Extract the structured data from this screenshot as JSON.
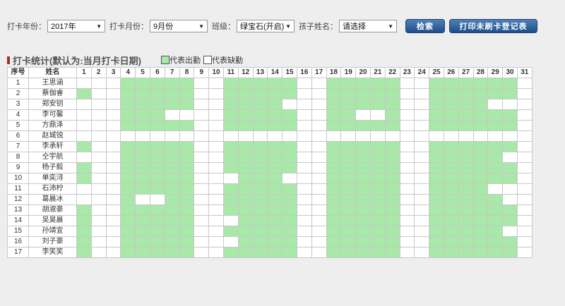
{
  "filters": {
    "year_label": "打卡年份：",
    "year_value": "2017年",
    "month_label": "打卡月份：",
    "month_value": "9月份",
    "class_label": "班级：",
    "class_value": "绿宝石(开启)",
    "child_label": "孩子姓名：",
    "child_value": "请选择",
    "search_button": "检索",
    "print_button": "打印未刷卡登记表"
  },
  "stats": {
    "title": "打卡统计(默认为:当月打卡日期)",
    "legend_present": "代表出勤",
    "legend_absent": "代表缺勤"
  },
  "colors": {
    "present": "#a8e8a8",
    "absent": "#ffffff",
    "button": "#2a5b96"
  },
  "table": {
    "header_no": "序号",
    "header_name": "姓名",
    "days": [
      "1",
      "2",
      "3",
      "4",
      "5",
      "6",
      "7",
      "8",
      "9",
      "10",
      "11",
      "12",
      "13",
      "14",
      "15",
      "16",
      "17",
      "18",
      "19",
      "20",
      "21",
      "22",
      "23",
      "24",
      "25",
      "26",
      "27",
      "28",
      "29",
      "30",
      "31"
    ],
    "rows": [
      {
        "no": "1",
        "name": "王思涵",
        "absent": [
          1
        ]
      },
      {
        "no": "2",
        "name": "蔡伽睿",
        "absent": []
      },
      {
        "no": "3",
        "name": "郑安钥",
        "absent": [
          1,
          15,
          29,
          30
        ]
      },
      {
        "no": "4",
        "name": "李可馨",
        "absent": [
          1,
          7,
          8,
          20,
          21
        ]
      },
      {
        "no": "5",
        "name": "方鼎泽",
        "absent": [
          1
        ]
      },
      {
        "no": "6",
        "name": "赵城锐",
        "absent": "all"
      },
      {
        "no": "7",
        "name": "李承轩",
        "absent": []
      },
      {
        "no": "8",
        "name": "仝宇航",
        "absent": [
          1,
          30
        ]
      },
      {
        "no": "9",
        "name": "杨子毅",
        "absent": []
      },
      {
        "no": "10",
        "name": "单奕浔",
        "absent": [
          11,
          15
        ]
      },
      {
        "no": "11",
        "name": "石沛柠",
        "absent": [
          1,
          29,
          30
        ]
      },
      {
        "no": "12",
        "name": "葛晨冰",
        "absent": [
          1,
          5,
          6,
          30
        ]
      },
      {
        "no": "13",
        "name": "胡淑豪",
        "absent": []
      },
      {
        "no": "14",
        "name": "吴昊晨",
        "absent": [
          11
        ]
      },
      {
        "no": "15",
        "name": "孙靖宜",
        "absent": [
          30
        ]
      },
      {
        "no": "16",
        "name": "刘子豪",
        "absent": [
          11
        ]
      },
      {
        "no": "17",
        "name": "李笑笑",
        "absent": []
      }
    ],
    "base_absent_days": [
      2,
      3,
      9,
      10,
      16,
      17,
      23,
      24,
      31
    ]
  }
}
